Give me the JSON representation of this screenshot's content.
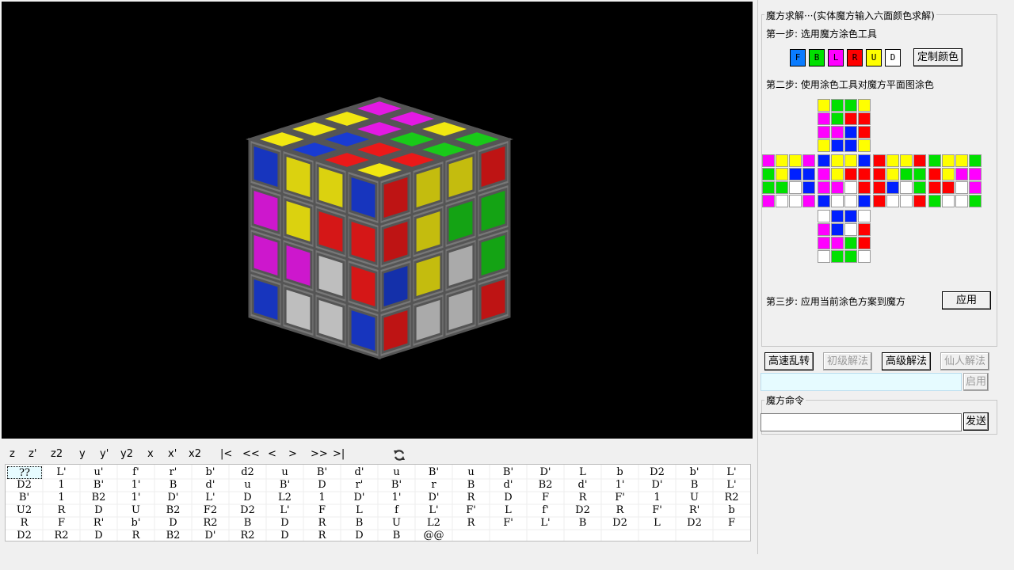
{
  "toolbar": {
    "buttons": [
      "z",
      "z'",
      "z2",
      "y",
      "y'",
      "y2",
      "x",
      "x'",
      "x2",
      "|<",
      "<<",
      "<",
      ">",
      ">>",
      ">|"
    ],
    "refresh_icon": "refresh-icon"
  },
  "moves": [
    [
      "??",
      "L'",
      "u'",
      "f'",
      "r'",
      "b'",
      "d2",
      "u",
      "B'",
      "d'",
      "u",
      "B'",
      "u",
      "B'",
      "D'",
      "L",
      "b",
      "D2",
      "b'",
      "L'"
    ],
    [
      "D2",
      "1",
      "B'",
      "1'",
      "B",
      "d'",
      "u",
      "B'",
      "D",
      "r'",
      "B'",
      "r",
      "B",
      "d'",
      "B2",
      "d'",
      "1'",
      "D'",
      "B",
      "L'"
    ],
    [
      "B'",
      "1",
      "B2",
      "1'",
      "D'",
      "L'",
      "D",
      "L2",
      "1",
      "D'",
      "1'",
      "D'",
      "R",
      "D",
      "F",
      "R",
      "F'",
      "1",
      "U",
      "R2"
    ],
    [
      "U2",
      "R",
      "D",
      "U",
      "B2",
      "F2",
      "D2",
      "L'",
      "F",
      "L",
      "f",
      "L'",
      "F'",
      "L",
      "f'",
      "D2",
      "R",
      "F'",
      "R'",
      "b"
    ],
    [
      "R",
      "F",
      "R'",
      "b'",
      "D",
      "R2",
      "B",
      "D",
      "R",
      "B",
      "U",
      "L2",
      "R",
      "F'",
      "L'",
      "B",
      "D2",
      "L",
      "D2",
      "F"
    ],
    [
      "D2",
      "R2",
      "D",
      "R",
      "B2",
      "D'",
      "R2",
      "D",
      "R",
      "D",
      "B",
      "@@"
    ]
  ],
  "solver": {
    "title": "魔方求解···(实体魔方输入六面颜色求解)",
    "step1": "第一步: 选用魔方涂色工具",
    "colors": [
      {
        "key": "F",
        "color": "#0a7cff"
      },
      {
        "key": "B",
        "color": "#00e000"
      },
      {
        "key": "L",
        "color": "#ff00ff"
      },
      {
        "key": "R",
        "color": "#ff0000"
      },
      {
        "key": "U",
        "color": "#ffff00"
      },
      {
        "key": "D",
        "color": "#ffffff"
      }
    ],
    "custom_color_label": "定制颜色",
    "step2": "第二步: 使用涂色工具对魔方平面图涂色",
    "step3": "第三步: 应用当前涂色方案到魔方",
    "apply_label": "应用"
  },
  "net": {
    "U": [
      [
        "Y",
        "G",
        "G",
        "Y"
      ],
      [
        "M",
        "G",
        "R",
        "R"
      ],
      [
        "M",
        "M",
        "B",
        "R"
      ],
      [
        "Y",
        "B",
        "B",
        "Y"
      ]
    ],
    "L": [
      [
        "M",
        "Y",
        "Y",
        "M"
      ],
      [
        "G",
        "Y",
        "B",
        "B"
      ],
      [
        "G",
        "G",
        "W",
        "B"
      ],
      [
        "M",
        "W",
        "W",
        "M"
      ]
    ],
    "F": [
      [
        "B",
        "Y",
        "Y",
        "B"
      ],
      [
        "M",
        "Y",
        "R",
        "R"
      ],
      [
        "M",
        "M",
        "W",
        "R"
      ],
      [
        "B",
        "W",
        "W",
        "B"
      ]
    ],
    "R": [
      [
        "R",
        "Y",
        "Y",
        "R"
      ],
      [
        "R",
        "Y",
        "G",
        "G"
      ],
      [
        "R",
        "B",
        "W",
        "G"
      ],
      [
        "R",
        "W",
        "W",
        "R"
      ]
    ],
    "B": [
      [
        "G",
        "Y",
        "Y",
        "G"
      ],
      [
        "R",
        "Y",
        "M",
        "M"
      ],
      [
        "R",
        "R",
        "W",
        "M"
      ],
      [
        "G",
        "W",
        "W",
        "G"
      ]
    ],
    "D": [
      [
        "W",
        "B",
        "B",
        "W"
      ],
      [
        "M",
        "B",
        "W",
        "R"
      ],
      [
        "M",
        "M",
        "G",
        "R"
      ],
      [
        "W",
        "G",
        "G",
        "W"
      ]
    ],
    "palette": {
      "Y": "#ffff00",
      "G": "#00e000",
      "M": "#ff00ff",
      "R": "#ff0000",
      "B": "#0020ff",
      "W": "#ffffff"
    }
  },
  "actions": {
    "scramble": "高速乱转",
    "beginner": "初级解法",
    "advanced": "高级解法",
    "immortal": "仙人解法",
    "enable": "启用"
  },
  "command": {
    "title": "魔方命令",
    "send": "发送",
    "value": ""
  },
  "cube": {
    "face_colors": {
      "Y": "#e6dd10",
      "G": "#18c018",
      "M": "#d818d8",
      "R": "#e01818",
      "B": "#1838c8",
      "W": "#c8c8c8"
    },
    "top": [
      [
        "M",
        "M",
        "Y",
        "G"
      ],
      [
        "Y",
        "M",
        "G",
        "G"
      ],
      [
        "Y",
        "B",
        "R",
        "R"
      ],
      [
        "Y",
        "B",
        "R",
        "Y"
      ]
    ],
    "left": [
      [
        "B",
        "Y",
        "Y",
        "B"
      ],
      [
        "M",
        "Y",
        "R",
        "R"
      ],
      [
        "M",
        "M",
        "W",
        "R"
      ],
      [
        "B",
        "W",
        "W",
        "B"
      ]
    ],
    "right": [
      [
        "R",
        "Y",
        "Y",
        "R"
      ],
      [
        "R",
        "Y",
        "G",
        "G"
      ],
      [
        "B",
        "Y",
        "W",
        "G"
      ],
      [
        "R",
        "W",
        "W",
        "R"
      ]
    ]
  }
}
